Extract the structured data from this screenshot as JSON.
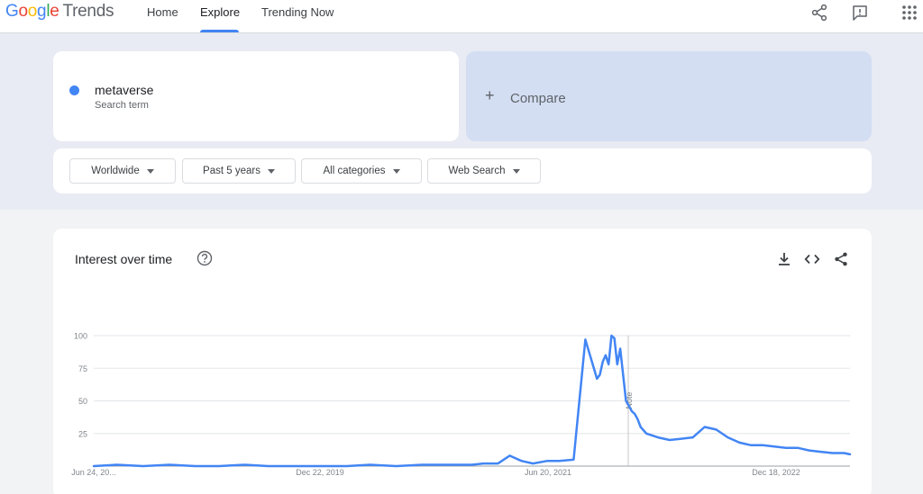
{
  "header": {
    "logo": {
      "google": "Google",
      "trends": "Trends"
    },
    "nav": [
      "Home",
      "Explore",
      "Trending Now"
    ],
    "active_nav": "Explore",
    "icons": [
      "share-icon",
      "feedback-icon",
      "apps-grid-icon"
    ]
  },
  "search": {
    "term": "metaverse",
    "term_type": "Search term",
    "term_color": "#4285f4",
    "compare_label": "Compare"
  },
  "filters": {
    "region": "Worldwide",
    "time": "Past 5 years",
    "category": "All categories",
    "property": "Web Search"
  },
  "chart_card": {
    "title": "Interest over time",
    "actions": [
      "download-icon",
      "embed-icon",
      "share-icon"
    ],
    "note_label": "Note"
  },
  "chart_data": {
    "type": "line",
    "title": "Interest over time",
    "xlabel": "",
    "ylabel": "",
    "ylim": [
      0,
      100
    ],
    "y_ticks": [
      25,
      50,
      75,
      100
    ],
    "x_tick_labels": [
      "Jun 24, 20...",
      "Dec 22, 2019",
      "Jun 20, 2021",
      "Dec 18, 2022"
    ],
    "grid": true,
    "series": [
      {
        "name": "metaverse",
        "color": "#4285f4",
        "x": [
          "2018-06-24",
          "2018-08-19",
          "2018-10-21",
          "2018-12-23",
          "2019-02-24",
          "2019-04-21",
          "2019-06-23",
          "2019-08-18",
          "2019-10-20",
          "2019-12-22",
          "2020-02-23",
          "2020-04-19",
          "2020-06-21",
          "2020-08-23",
          "2020-10-18",
          "2020-12-20",
          "2021-01-17",
          "2021-02-21",
          "2021-03-21",
          "2021-04-18",
          "2021-05-16",
          "2021-06-20",
          "2021-07-18",
          "2021-08-22",
          "2021-09-19",
          "2021-10-17",
          "2021-10-24",
          "2021-10-31",
          "2021-11-07",
          "2021-11-14",
          "2021-11-21",
          "2021-11-28",
          "2021-12-05",
          "2021-12-12",
          "2021-12-19",
          "2021-12-26",
          "2022-01-02",
          "2022-01-09",
          "2022-01-16",
          "2022-01-23",
          "2022-01-30",
          "2022-02-13",
          "2022-03-13",
          "2022-04-10",
          "2022-05-08",
          "2022-06-05",
          "2022-07-03",
          "2022-07-31",
          "2022-08-28",
          "2022-09-25",
          "2022-10-23",
          "2022-11-20",
          "2022-12-18",
          "2023-01-15",
          "2023-02-12",
          "2023-03-12",
          "2023-04-09",
          "2023-05-07",
          "2023-06-04",
          "2023-06-18"
        ],
        "values": [
          0,
          1,
          0,
          1,
          0,
          0,
          1,
          0,
          0,
          0,
          0,
          1,
          0,
          1,
          1,
          1,
          2,
          2,
          8,
          4,
          2,
          4,
          4,
          5,
          97,
          67,
          70,
          80,
          85,
          78,
          100,
          98,
          78,
          90,
          70,
          50,
          46,
          42,
          40,
          36,
          30,
          25,
          22,
          20,
          21,
          22,
          30,
          28,
          22,
          18,
          16,
          16,
          15,
          14,
          14,
          12,
          11,
          10,
          10,
          9
        ]
      }
    ]
  }
}
